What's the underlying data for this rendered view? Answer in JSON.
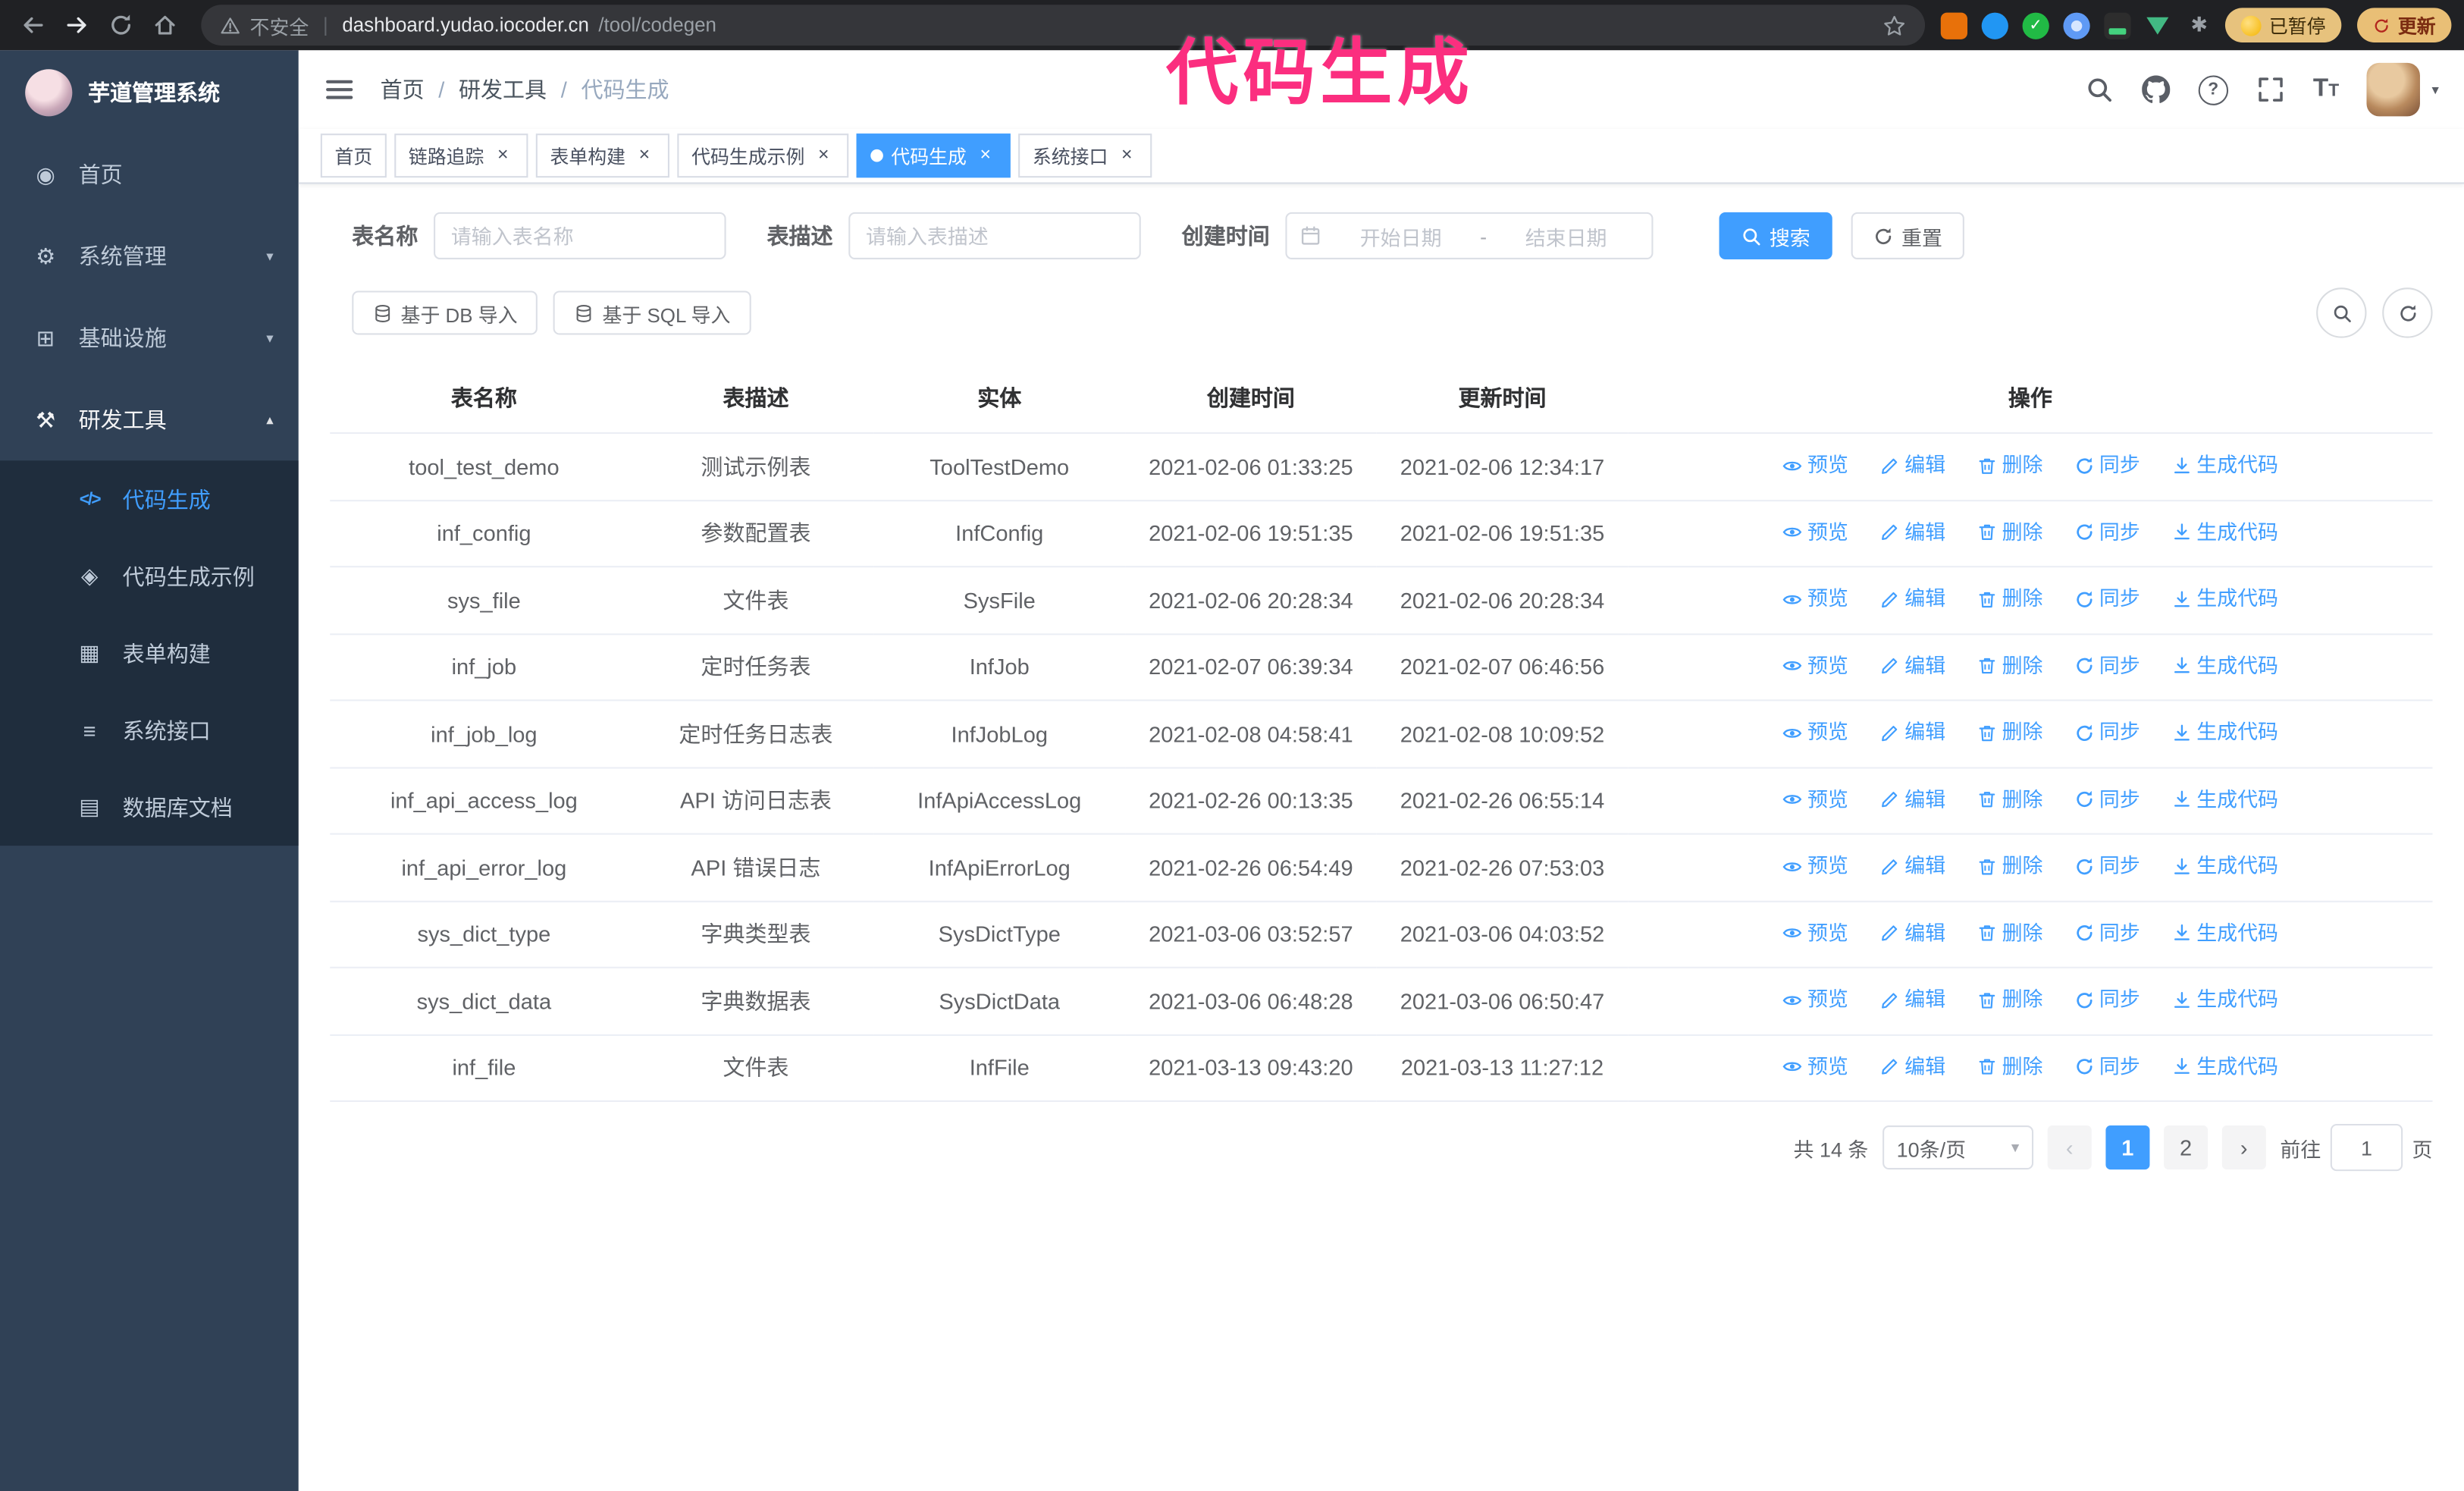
{
  "browser": {
    "security_label": "不安全",
    "url_host": "dashboard.yudao.iocoder.cn",
    "url_path": "/tool/codegen",
    "paused_badge": "已暂停",
    "update_button": "更新"
  },
  "annotation": {
    "text": "代码生成"
  },
  "sidebar": {
    "logo_title": "芋道管理系统",
    "items": [
      {
        "label": "首页"
      },
      {
        "label": "系统管理"
      },
      {
        "label": "基础设施"
      },
      {
        "label": "研发工具"
      }
    ],
    "subitems": [
      {
        "label": "代码生成"
      },
      {
        "label": "代码生成示例"
      },
      {
        "label": "表单构建"
      },
      {
        "label": "系统接口"
      },
      {
        "label": "数据库文档"
      }
    ]
  },
  "header": {
    "breadcrumb": [
      "首页",
      "研发工具",
      "代码生成"
    ]
  },
  "tabs": [
    "首页",
    "链路追踪",
    "表单构建",
    "代码生成示例",
    "代码生成",
    "系统接口"
  ],
  "filters": {
    "table_name_label": "表名称",
    "table_name_placeholder": "请输入表名称",
    "table_desc_label": "表描述",
    "table_desc_placeholder": "请输入表描述",
    "create_time_label": "创建时间",
    "date_start_placeholder": "开始日期",
    "date_separator": "-",
    "date_end_placeholder": "结束日期",
    "search_button": "搜索",
    "reset_button": "重置"
  },
  "toolbar": {
    "import_db_button": "基于 DB 导入",
    "import_sql_button": "基于 SQL 导入"
  },
  "table": {
    "columns": [
      "表名称",
      "表描述",
      "实体",
      "创建时间",
      "更新时间",
      "操作"
    ],
    "actions": [
      "预览",
      "编辑",
      "删除",
      "同步",
      "生成代码"
    ],
    "rows": [
      [
        "tool_test_demo",
        "测试示例表",
        "ToolTestDemo",
        "2021-02-06 01:33:25",
        "2021-02-06 12:34:17"
      ],
      [
        "inf_config",
        "参数配置表",
        "InfConfig",
        "2021-02-06 19:51:35",
        "2021-02-06 19:51:35"
      ],
      [
        "sys_file",
        "文件表",
        "SysFile",
        "2021-02-06 20:28:34",
        "2021-02-06 20:28:34"
      ],
      [
        "inf_job",
        "定时任务表",
        "InfJob",
        "2021-02-07 06:39:34",
        "2021-02-07 06:46:56"
      ],
      [
        "inf_job_log",
        "定时任务日志表",
        "InfJobLog",
        "2021-02-08 04:58:41",
        "2021-02-08 10:09:52"
      ],
      [
        "inf_api_access_log",
        "API 访问日志表",
        "InfApiAccessLog",
        "2021-02-26 00:13:35",
        "2021-02-26 06:55:14"
      ],
      [
        "inf_api_error_log",
        "API 错误日志",
        "InfApiErrorLog",
        "2021-02-26 06:54:49",
        "2021-02-26 07:53:03"
      ],
      [
        "sys_dict_type",
        "字典类型表",
        "SysDictType",
        "2021-03-06 03:52:57",
        "2021-03-06 04:03:52"
      ],
      [
        "sys_dict_data",
        "字典数据表",
        "SysDictData",
        "2021-03-06 06:48:28",
        "2021-03-06 06:50:47"
      ],
      [
        "inf_file",
        "文件表",
        "InfFile",
        "2021-03-13 09:43:20",
        "2021-03-13 11:27:12"
      ]
    ]
  },
  "pagination": {
    "total": "共 14 条",
    "page_size": "10条/页",
    "page_1": "1",
    "page_2": "2",
    "goto_label": "前往",
    "goto_value": "1",
    "goto_unit": "页"
  },
  "colors": {
    "primary": "#409eff",
    "sidebar_bg": "#304156",
    "submenu_bg": "#1f2d3d",
    "annotation_pink": "#fb2e7f"
  }
}
